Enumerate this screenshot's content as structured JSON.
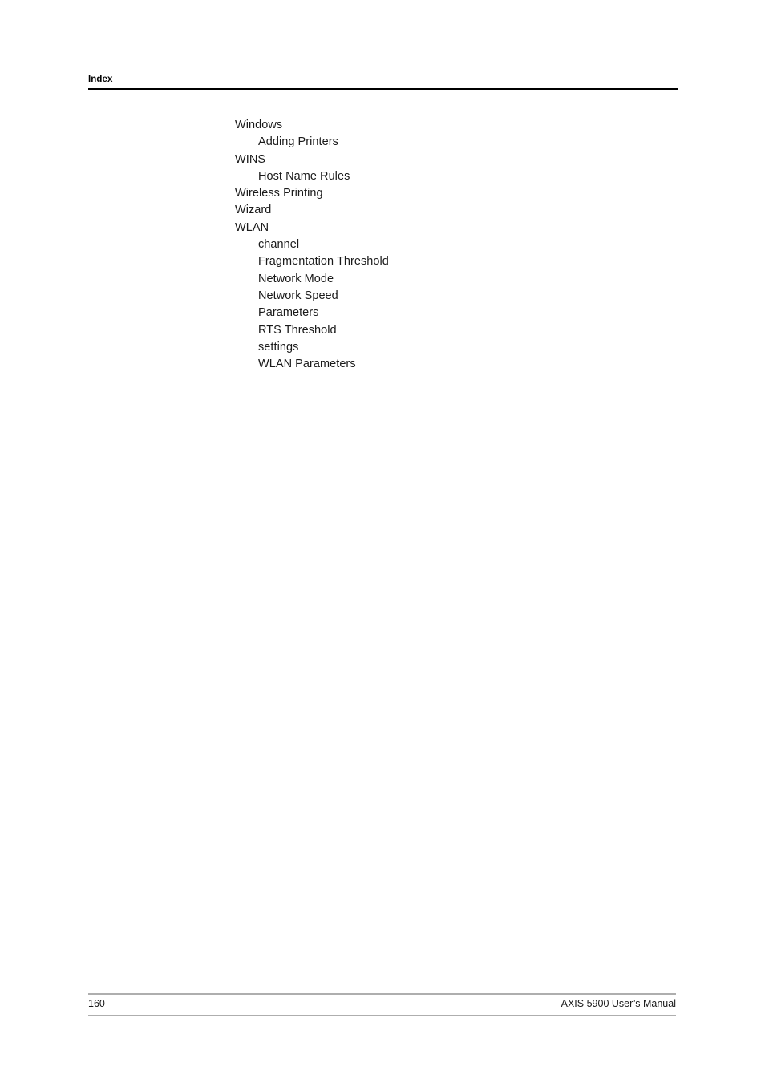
{
  "header": {
    "title": "Index"
  },
  "index": {
    "entries": [
      {
        "text": "Windows",
        "level": 1
      },
      {
        "text": "Adding Printers",
        "level": 2
      },
      {
        "text": "WINS",
        "level": 1
      },
      {
        "text": "Host Name Rules",
        "level": 2
      },
      {
        "text": "Wireless Printing",
        "level": 1
      },
      {
        "text": "Wizard",
        "level": 1
      },
      {
        "text": "WLAN",
        "level": 1
      },
      {
        "text": "channel",
        "level": 2
      },
      {
        "text": "Fragmentation Threshold",
        "level": 2
      },
      {
        "text": "Network Mode",
        "level": 2
      },
      {
        "text": "Network Speed",
        "level": 2
      },
      {
        "text": "Parameters",
        "level": 2
      },
      {
        "text": "RTS Threshold",
        "level": 2
      },
      {
        "text": "settings",
        "level": 2
      },
      {
        "text": "WLAN Parameters",
        "level": 2
      }
    ]
  },
  "footer": {
    "page_number": "160",
    "manual_title": "AXIS 5900 User’s Manual"
  },
  "colors": {
    "text": "#1a1a1a",
    "header_rule": "#000000",
    "footer_rule": "#aeaeae",
    "page_background": "#ffffff"
  }
}
